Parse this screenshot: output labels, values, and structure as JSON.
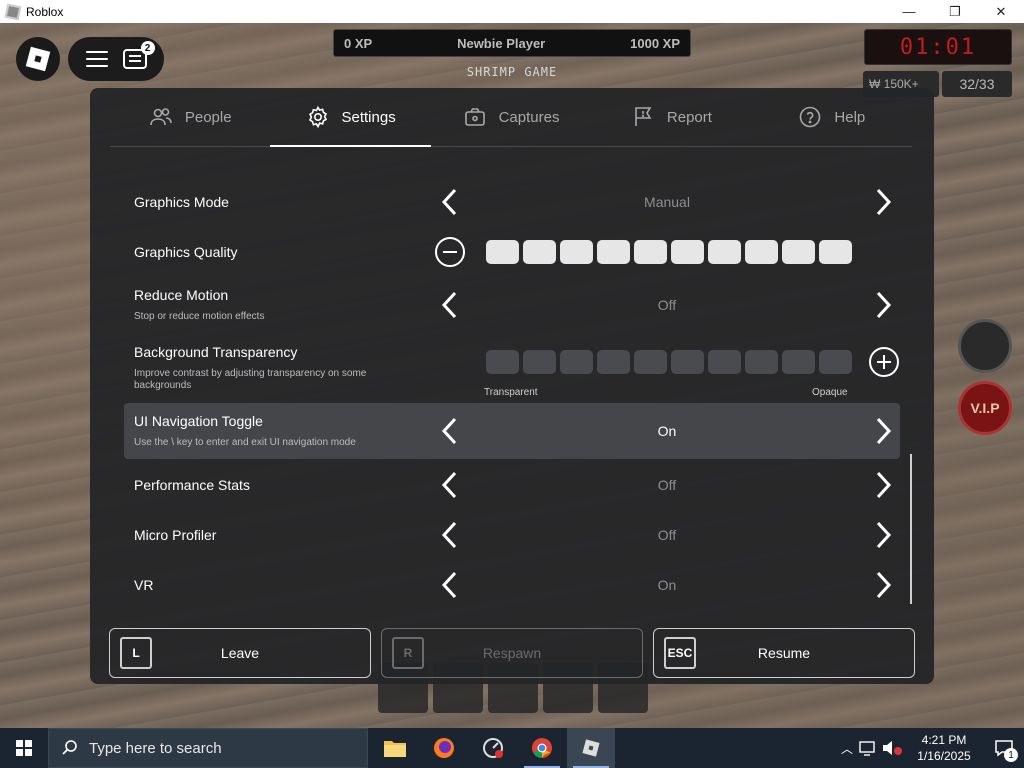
{
  "window": {
    "title": "Roblox",
    "minimize": "—",
    "maximize": "❐",
    "close": "✕"
  },
  "hud": {
    "chat_count": "2",
    "xp_left": "0 XP",
    "rank": "Newbie Player",
    "xp_right": "1000 XP",
    "game_name": "SHRIMP GAME",
    "timer": "01:01",
    "money": "₩ 150K+",
    "players": "32/33",
    "vip": "V.I.P"
  },
  "tabs": [
    {
      "label": "People",
      "icon": "people-icon"
    },
    {
      "label": "Settings",
      "icon": "gear-icon",
      "active": true
    },
    {
      "label": "Captures",
      "icon": "camera-icon"
    },
    {
      "label": "Report",
      "icon": "flag-icon"
    },
    {
      "label": "Help",
      "icon": "help-icon"
    }
  ],
  "settings": {
    "graphics_mode": {
      "title": "Graphics Mode",
      "value": "Manual"
    },
    "graphics_quality": {
      "title": "Graphics Quality",
      "level": 10,
      "max": 10
    },
    "reduce_motion": {
      "title": "Reduce Motion",
      "subtitle": "Stop or reduce motion effects",
      "value": "Off"
    },
    "background_transparency": {
      "title": "Background Transparency",
      "subtitle": "Improve contrast by adjusting transparency on some backgrounds",
      "left_label": "Transparent",
      "right_label": "Opaque",
      "level": 0,
      "max": 10
    },
    "ui_navigation": {
      "title": "UI Navigation Toggle",
      "subtitle": "Use the \\ key to enter and exit UI navigation mode",
      "value": "On"
    },
    "performance_stats": {
      "title": "Performance Stats",
      "value": "Off"
    },
    "micro_profiler": {
      "title": "Micro Profiler",
      "value": "Off"
    },
    "vr": {
      "title": "VR",
      "value": "On"
    }
  },
  "actions": {
    "leave": {
      "key": "L",
      "label": "Leave"
    },
    "respawn": {
      "key": "R",
      "label": "Respawn"
    },
    "resume": {
      "key": "ESC",
      "label": "Resume"
    }
  },
  "taskbar": {
    "search_placeholder": "Type here to search",
    "time": "4:21 PM",
    "date": "1/16/2025",
    "notifications": "1"
  }
}
